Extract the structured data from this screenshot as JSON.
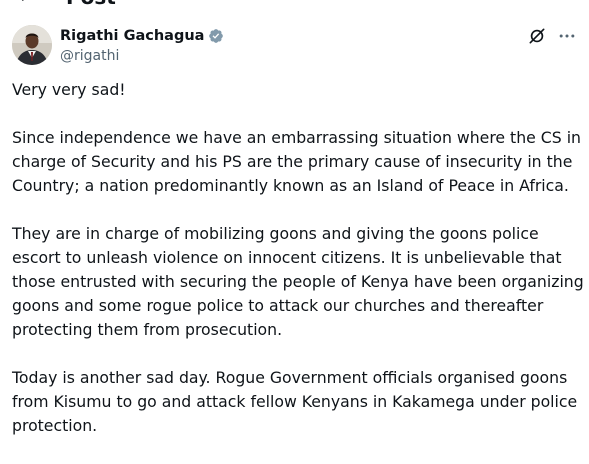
{
  "header": {
    "title": "Post"
  },
  "author": {
    "display_name": "Rigathi Gachagua",
    "handle": "@rigathi",
    "verified": true
  },
  "tweet": {
    "paragraphs": [
      "Very very sad!",
      "Since independence we have an embarrassing situation where the CS in charge of Security and his PS are the primary cause of insecurity in the Country; a nation predominantly known as an Island of Peace in Africa.",
      "They are in charge of mobilizing goons and giving the goons police escort to unleash violence on innocent citizens. It is unbelievable that those entrusted with securing the people of Kenya have been organizing goons and some rogue police to attack our churches and thereafter protecting them from prosecution.",
      "Today is another sad day. Rogue Government officials organised goons from Kisumu to go and attack fellow Kenyans in Kakamega under police protection."
    ]
  },
  "icons": {
    "back": "back-arrow-icon",
    "verified": "verified-badge-icon",
    "grok": "grok-icon",
    "more": "more-options-icon"
  },
  "colors": {
    "text": "#0f1419",
    "secondary": "#536471",
    "verified": "#829aab"
  }
}
